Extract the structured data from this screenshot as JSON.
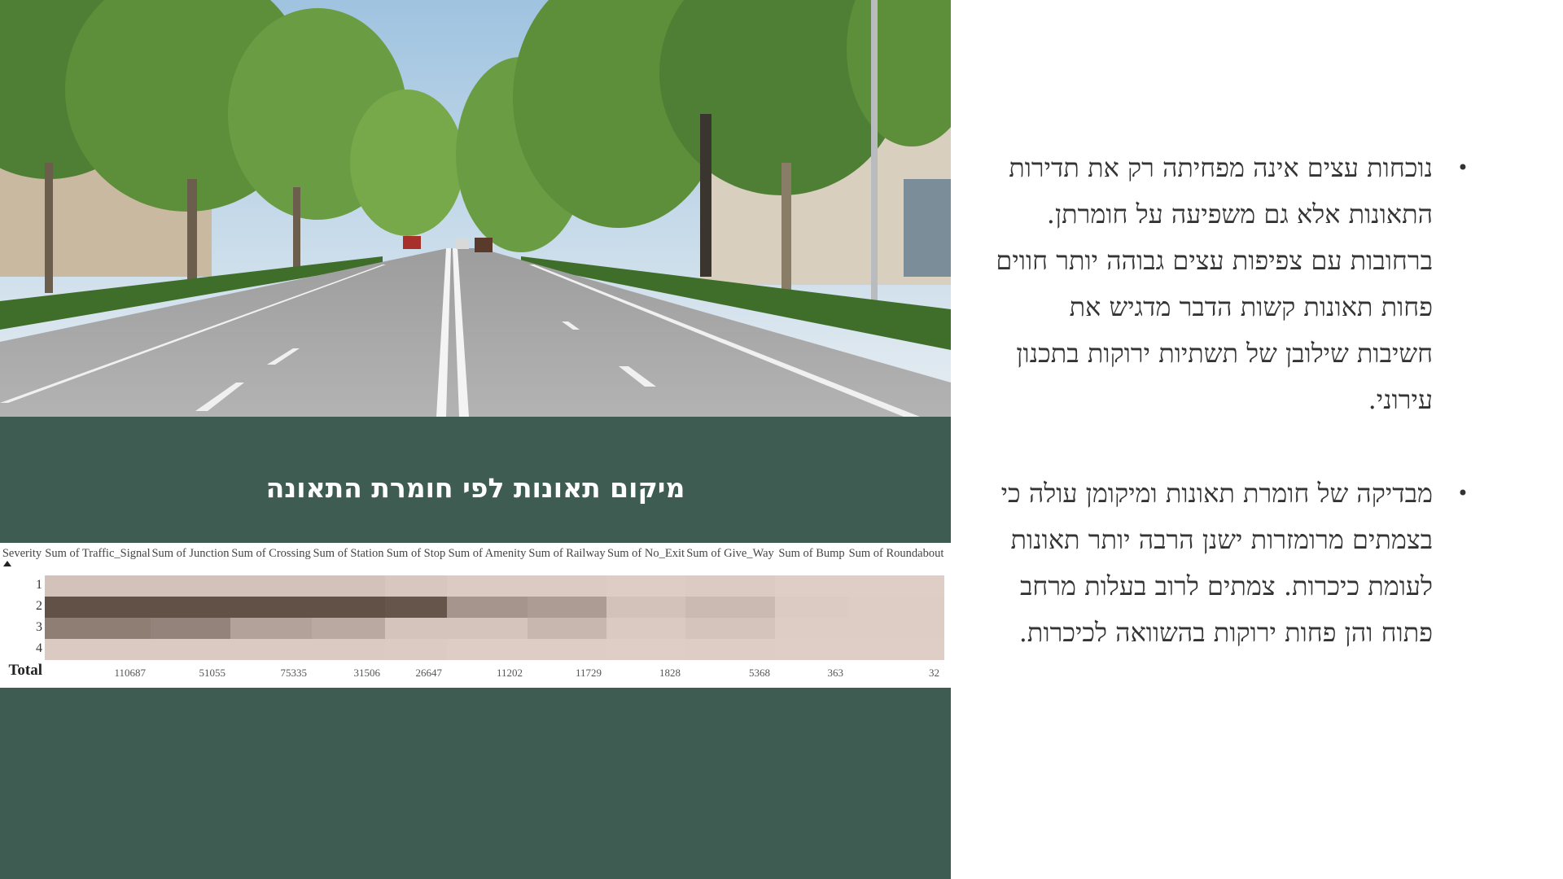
{
  "slide": {
    "photo_alt": "tree-lined boulevard",
    "title": "מיקום תאונות לפי חומרת התאונה",
    "bullets": [
      "נוכחות עצים אינה מפחיתה רק את תדירות התאונות אלא גם משפיעה על חומרתן. ברחובות עם צפיפות עצים גבוהה יותר חווים פחות תאונות קשות הדבר מדגיש את חשיבות שילובן של תשתיות ירוקות בתכנון עירוני.",
      "מבדיקה של חומרת תאונות ומיקומן עולה כי בצמתים מרומזרות ישנן הרבה יותר תאונות לעומת כיכרות. צמתים לרוב בעלות מרחב פתוח והן פחות ירוקות בהשוואה לכיכרות."
    ]
  },
  "heat_table": {
    "row_header": "Severity",
    "total_label": "Total",
    "rows": [
      "1",
      "2",
      "3",
      "4"
    ],
    "columns": [
      "Sum of Traffic_Signal",
      "Sum of Junction",
      "Sum of Crossing",
      "Sum of Station",
      "Sum of Stop",
      "Sum of Amenity",
      "Sum of Railway",
      "Sum of No_Exit",
      "Sum of Give_Way",
      "Sum of Bump",
      "Sum of Roundabout"
    ],
    "totals": [
      "110687",
      "51055",
      "75335",
      "31506",
      "26647",
      "11202",
      "11729",
      "1828",
      "5368",
      "363",
      "32"
    ],
    "intensity": [
      [
        0.12,
        0.12,
        0.12,
        0.12,
        0.08,
        0.05,
        0.05,
        0.04,
        0.05,
        0.03,
        0.03
      ],
      [
        0.95,
        0.95,
        0.95,
        0.95,
        0.92,
        0.45,
        0.4,
        0.12,
        0.18,
        0.05,
        0.04
      ],
      [
        0.62,
        0.58,
        0.35,
        0.3,
        0.1,
        0.1,
        0.2,
        0.06,
        0.1,
        0.04,
        0.04
      ],
      [
        0.06,
        0.06,
        0.06,
        0.06,
        0.05,
        0.04,
        0.04,
        0.03,
        0.04,
        0.03,
        0.03
      ]
    ],
    "colors": {
      "low": "#e3d2ca",
      "high": "#5a4a40"
    }
  }
}
